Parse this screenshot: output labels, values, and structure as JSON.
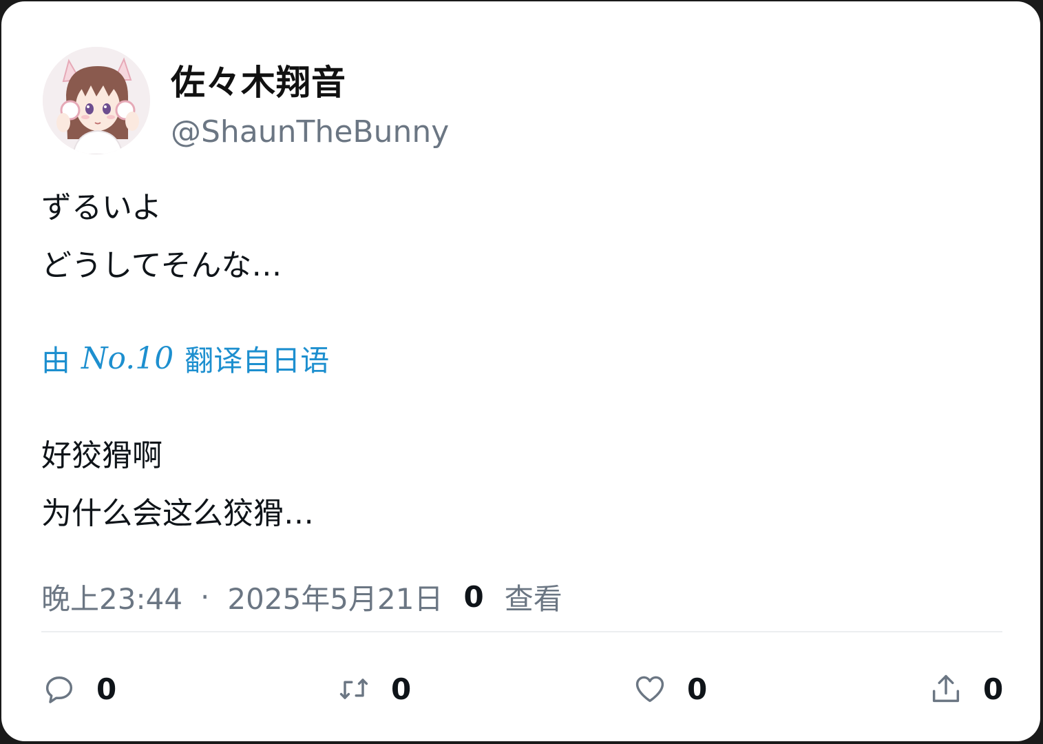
{
  "tweet": {
    "display_name": "佐々木翔音",
    "handle": "@ShaunTheBunny",
    "text_lines": [
      "ずるいよ",
      "どうしてそんな…"
    ],
    "translation_prefix": "由",
    "translation_engine": "No.10",
    "translation_suffix": "翻译自日语",
    "translated_lines": [
      "好狡猾啊",
      "为什么会这么狡猾…"
    ],
    "time": "晚上23:44",
    "separator": "·",
    "date": "2025年5月21日",
    "views_count": "0",
    "views_label": "查看"
  },
  "actions": {
    "reply": {
      "icon": "reply-icon",
      "count": "0"
    },
    "retweet": {
      "icon": "retweet-icon",
      "count": "0"
    },
    "like": {
      "icon": "heart-icon",
      "count": "0"
    },
    "share": {
      "icon": "share-icon",
      "count": "0"
    }
  },
  "colors": {
    "link": "#1d8fcf",
    "secondary_text": "#6b7683",
    "primary_text": "#0f1419"
  }
}
